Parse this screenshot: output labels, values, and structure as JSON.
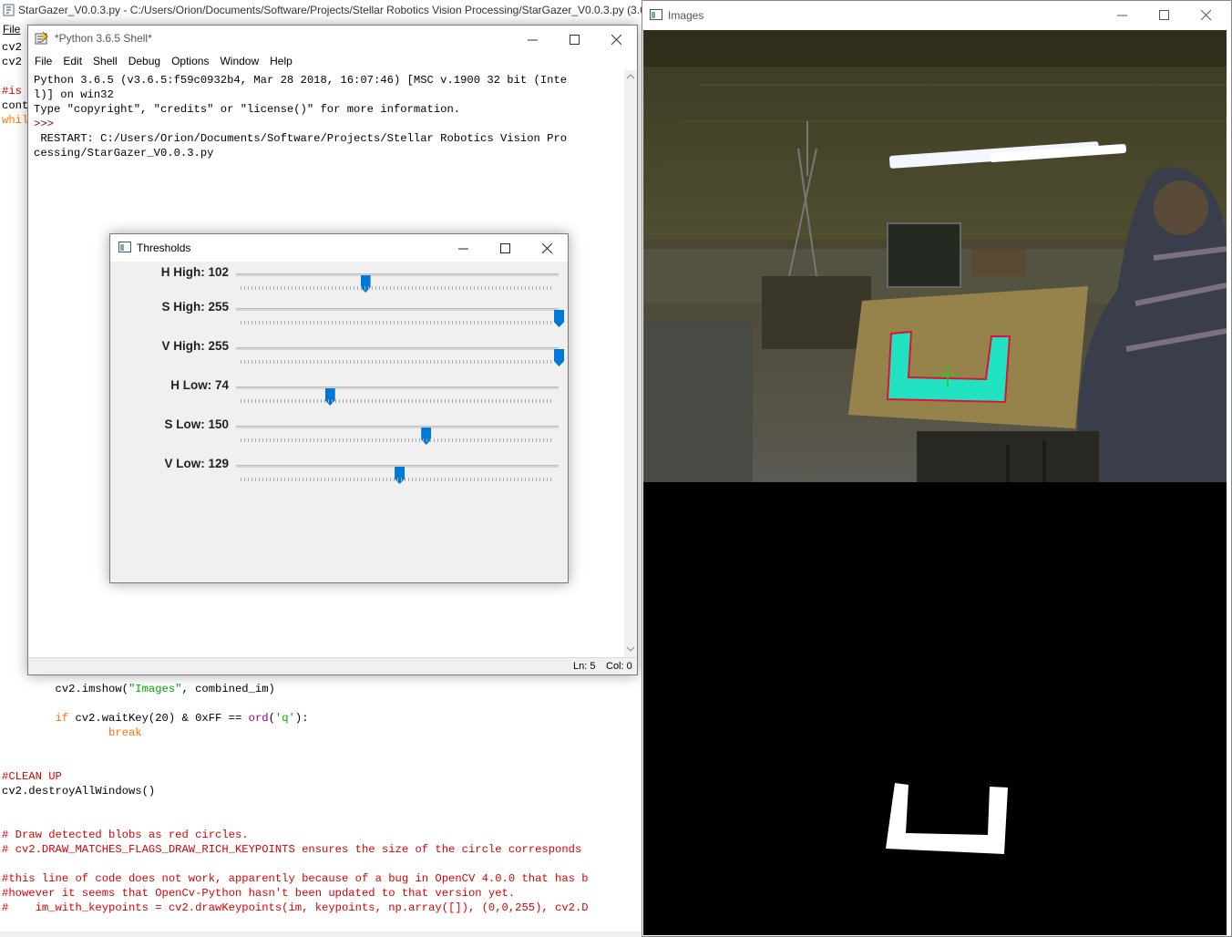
{
  "editor": {
    "title": "StarGazer_V0.0.3.py - C:/Users/Orion/Documents/Software/Projects/Stellar Robotics Vision Processing/StarGazer_V0.0.3.py (3.6.5)",
    "menu_file": "File",
    "partial_lines": [
      "cv2",
      "cv2",
      "",
      "#is",
      "cont",
      "whil"
    ],
    "code_imshow": "        cv2.imshow(\"Images\", combined_im)",
    "code_if": "        if cv2.waitKey(20) & 0xFF == ord('q'):",
    "code_break": "                break",
    "code_cleanup": "#CLEAN UP",
    "code_destroy": "cv2.destroyAllWindows()",
    "comment_1": "# Draw detected blobs as red circles.",
    "comment_2": "# cv2.DRAW_MATCHES_FLAGS_DRAW_RICH_KEYPOINTS ensures the size of the circle corresponds",
    "comment_3": "#this line of code does not work, apparently because of a bug in OpenCV 4.0.0 that has b",
    "comment_4": "#however it seems that OpenCv-Python hasn't been updated to that version yet.",
    "comment_5": "#    im_with_keypoints = cv2.drawKeypoints(im, keypoints, np.array([]), (0,0,255), cv2.D"
  },
  "shell": {
    "title": "*Python 3.6.5 Shell*",
    "menus": [
      "File",
      "Edit",
      "Shell",
      "Debug",
      "Options",
      "Window",
      "Help"
    ],
    "lines": [
      "Python 3.6.5 (v3.6.5:f59c0932b4, Mar 28 2018, 16:07:46) [MSC v.1900 32 bit (Inte",
      "l)] on win32",
      "Type \"copyright\", \"credits\" or \"license()\" for more information.",
      ">>> ",
      " RESTART: C:/Users/Orion/Documents/Software/Projects/Stellar Robotics Vision Pro",
      "cessing/StarGazer_V0.0.3.py"
    ],
    "status_ln": "Ln: 5",
    "status_col": "Col: 0"
  },
  "thresholds": {
    "title": "Thresholds",
    "max": 255,
    "sliders": [
      {
        "label": "H High: 102",
        "value": 102
      },
      {
        "label": "S High: 255",
        "value": 255
      },
      {
        "label": "V High: 255",
        "value": 255
      },
      {
        "label": "H Low: 74",
        "value": 74
      },
      {
        "label": "S Low: 150",
        "value": 150
      },
      {
        "label": "V Low: 129",
        "value": 129
      }
    ]
  },
  "images": {
    "title": "Images"
  },
  "colors": {
    "accent": "#0078d7",
    "target_fill": "#21e3c2",
    "target_outline": "#e0103a",
    "crosshair": "#22cc22"
  }
}
